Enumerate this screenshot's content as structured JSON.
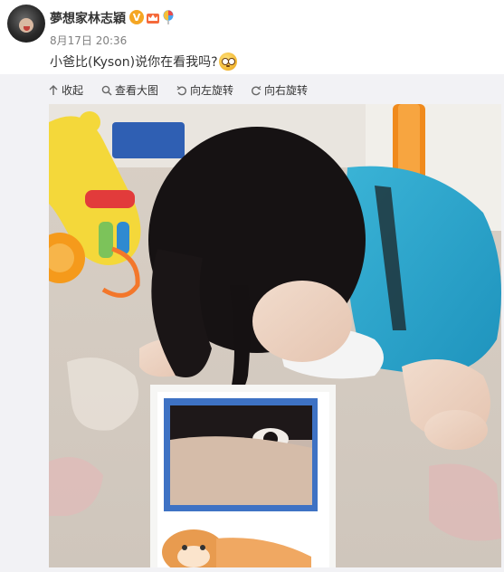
{
  "post": {
    "username": "夢想家林志穎",
    "time": "8月17日 20:36",
    "text": "小爸比(Kyson)说你在看我吗?",
    "badge_v": "V",
    "emoji_icon": "cute-wide-eyes-emoji-icon"
  },
  "toolbar": {
    "collapse": "收起",
    "view_large": "查看大图",
    "rotate_left": "向左旋转",
    "rotate_right": "向右旋转"
  },
  "colors": {
    "badge_v": "#f5a623",
    "panel_bg": "#f2f2f5",
    "time": "#808080",
    "text": "#333333"
  },
  "photo": {
    "description_icon": "baby-looking-into-mirror-photo"
  }
}
